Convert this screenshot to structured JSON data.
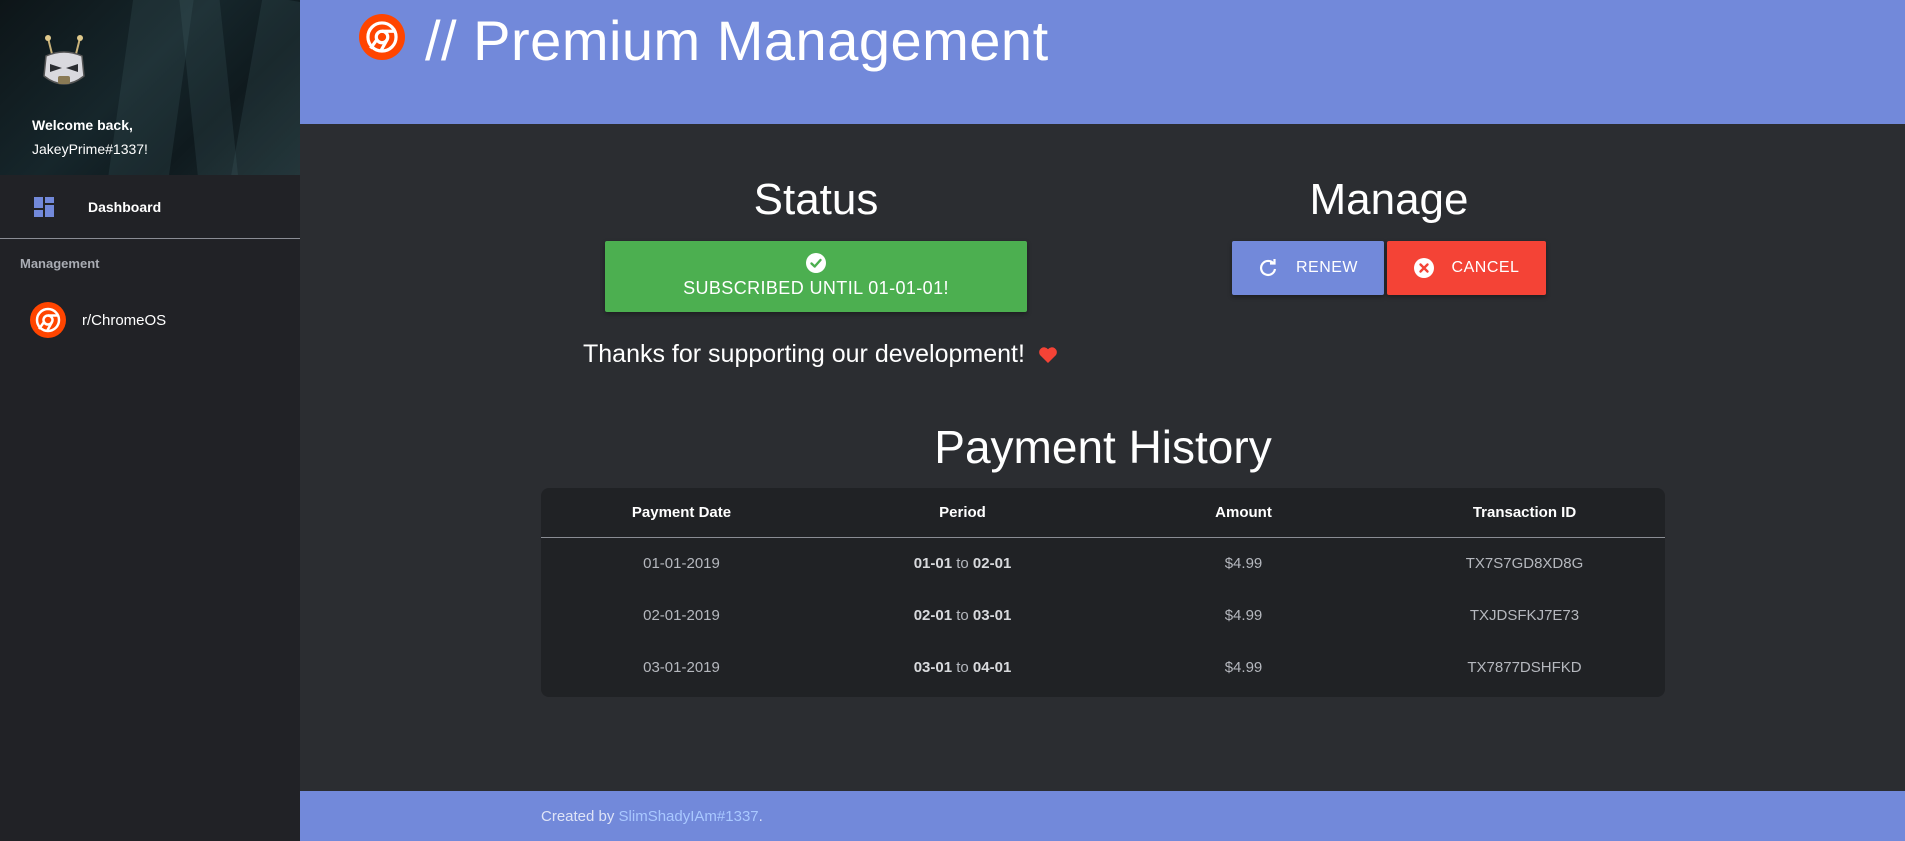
{
  "sidebar": {
    "welcome_line1": "Welcome back,",
    "welcome_line2": "JakeyPrime#1337!",
    "dashboard_label": "Dashboard",
    "section_label": "Management",
    "server_label": "r/ChromeOS"
  },
  "header": {
    "title": "// Premium Management",
    "icon": "chrome-logo-icon"
  },
  "status": {
    "title": "Status",
    "badge_text": "SUBSCRIBED UNTIL 01-01-01!",
    "badge_color": "#4caf50",
    "thanks_text": "Thanks for supporting our development!"
  },
  "manage": {
    "title": "Manage",
    "renew_label": "RENEW",
    "cancel_label": "CANCEL",
    "renew_color": "#7289da",
    "cancel_color": "#f44336"
  },
  "payment_history": {
    "title": "Payment History",
    "columns": [
      "Payment Date",
      "Period",
      "Amount",
      "Transaction ID"
    ],
    "rows": [
      {
        "date": "01-01-2019",
        "period_from": "01-01",
        "period_sep": "to",
        "period_to": "02-01",
        "amount": "$4.99",
        "txid": "TX7S7GD8XD8G"
      },
      {
        "date": "02-01-2019",
        "period_from": "02-01",
        "period_sep": "to",
        "period_to": "03-01",
        "amount": "$4.99",
        "txid": "TXJDSFKJ7E73"
      },
      {
        "date": "03-01-2019",
        "period_from": "03-01",
        "period_sep": "to",
        "period_to": "04-01",
        "amount": "$4.99",
        "txid": "TX7877DSHFKD"
      }
    ]
  },
  "footer": {
    "prefix": "Created by",
    "author": "SlimShadyIAm#1337",
    "suffix": "."
  },
  "colors": {
    "accent": "#7289da",
    "background": "#2b2d31",
    "sidebar": "#212226"
  }
}
